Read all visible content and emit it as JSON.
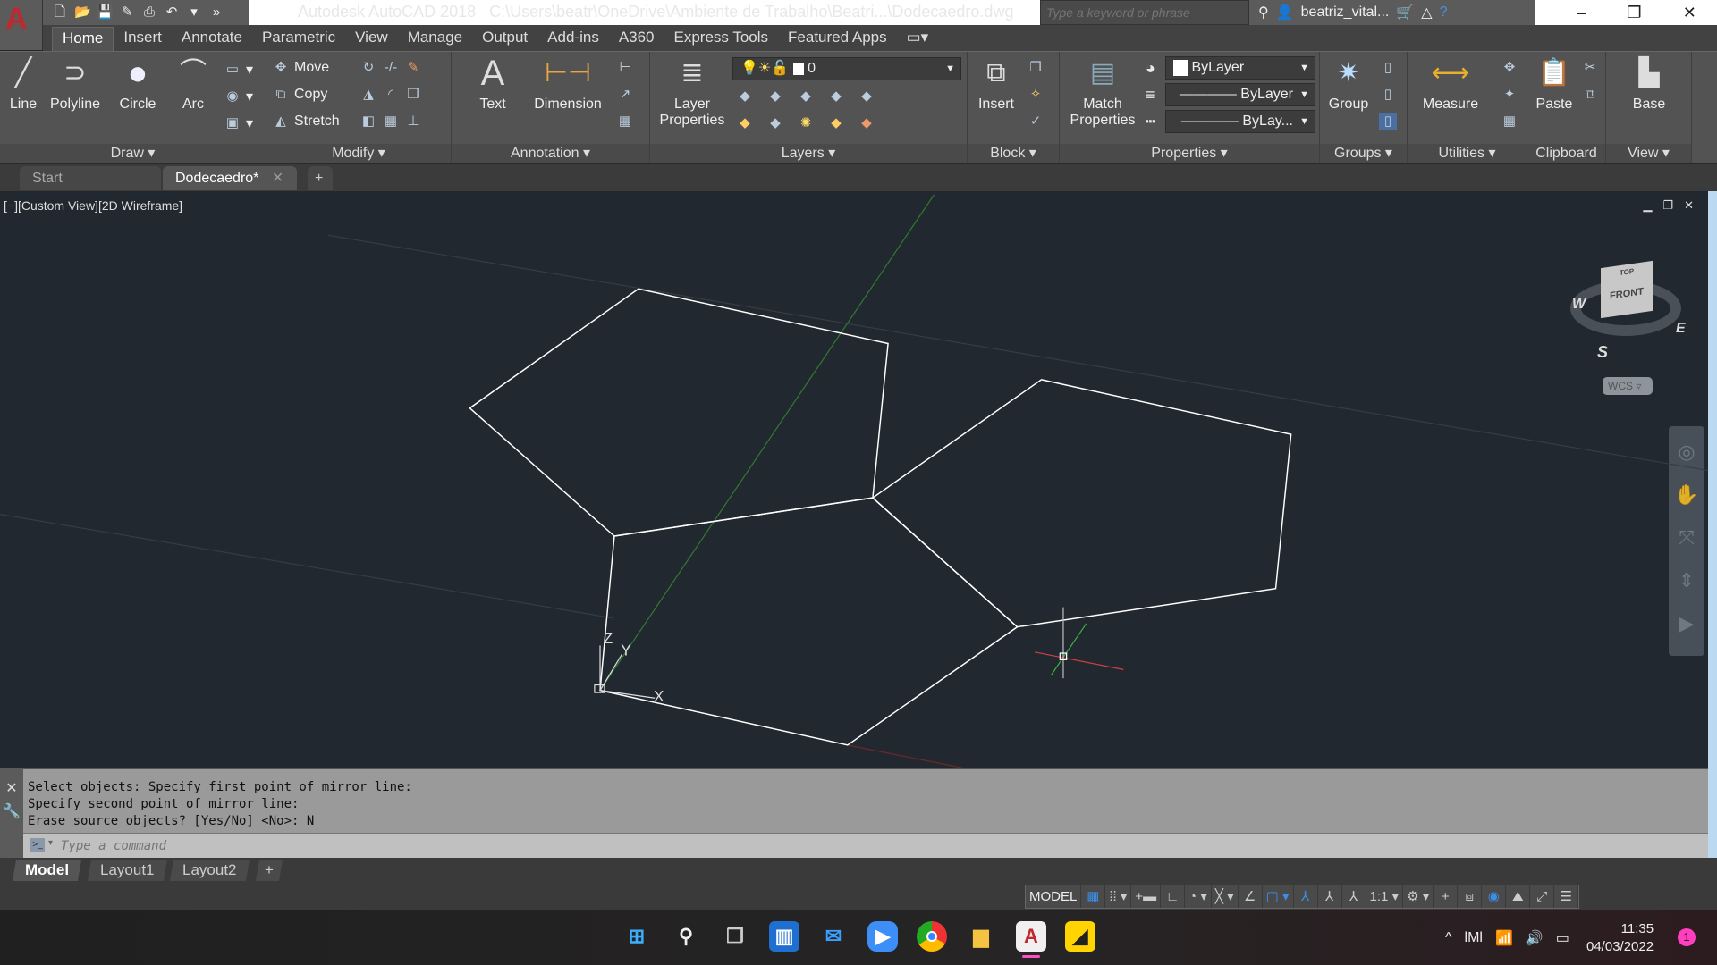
{
  "titlebar": {
    "app_title": "Autodesk AutoCAD 2018",
    "file_path": "C:\\Users\\beatr\\OneDrive\\Ambiente de Trabalho\\Beatri...\\Dodecaedro.dwg",
    "search_placeholder": "Type a keyword or phrase",
    "user": "beatriz_vital...",
    "app_letter": "A"
  },
  "ribbon_tabs": [
    "Home",
    "Insert",
    "Annotate",
    "Parametric",
    "View",
    "Manage",
    "Output",
    "Add-ins",
    "A360",
    "Express Tools",
    "Featured Apps"
  ],
  "panels": {
    "draw": {
      "label": "Draw",
      "tools": [
        "Line",
        "Polyline",
        "Circle",
        "Arc"
      ]
    },
    "modify": {
      "label": "Modify",
      "tools": [
        "Move",
        "Copy",
        "Stretch"
      ]
    },
    "annotation": {
      "label": "Annotation",
      "tools": [
        "Text",
        "Dimension"
      ]
    },
    "layers": {
      "label": "Layers",
      "tool": "Layer Properties",
      "current_layer": "0"
    },
    "block": {
      "label": "Block",
      "tool": "Insert"
    },
    "properties": {
      "label": "Properties",
      "tool": "Match Properties",
      "color": "ByLayer",
      "linetype": "ByLayer",
      "lineweight": "ByLay..."
    },
    "groups": {
      "label": "Groups",
      "tool": "Group"
    },
    "utilities": {
      "label": "Utilities",
      "tool": "Measure"
    },
    "clipboard": {
      "label": "Clipboard",
      "tool": "Paste"
    },
    "view": {
      "label": "View",
      "tool": "Base"
    }
  },
  "file_tabs": [
    {
      "label": "Start"
    },
    {
      "label": "Dodecaedro*",
      "active": true
    }
  ],
  "viewport": {
    "label": "[−][Custom View][2D Wireframe]",
    "viewcube": {
      "top": "TOP",
      "front": "FRONT",
      "compass": [
        "W",
        "E",
        "S"
      ],
      "ucs": "WCS"
    },
    "ucs_axes": [
      "Z",
      "Y",
      "X"
    ],
    "colors": {
      "background": "#212830",
      "geometry": "#ffffff",
      "y_axis": "#3fae3f",
      "x_axis": "#d04040"
    }
  },
  "command": {
    "history": [
      "Select objects:  Specify first point of mirror line:",
      "Specify second point of mirror line:",
      "Erase source objects? [Yes/No] <No>: N"
    ],
    "placeholder": "Type a command"
  },
  "layout_tabs": [
    "Model",
    "Layout1",
    "Layout2"
  ],
  "status": {
    "model": "MODEL",
    "scale": "1:1"
  },
  "taskbar": {
    "apps": [
      "windows-start",
      "search",
      "task-view",
      "widgets",
      "mail",
      "zoom",
      "chrome",
      "file-explorer",
      "autocad",
      "sticky-notes"
    ],
    "time": "11:35",
    "date": "04/03/2022",
    "notifications": "1"
  }
}
